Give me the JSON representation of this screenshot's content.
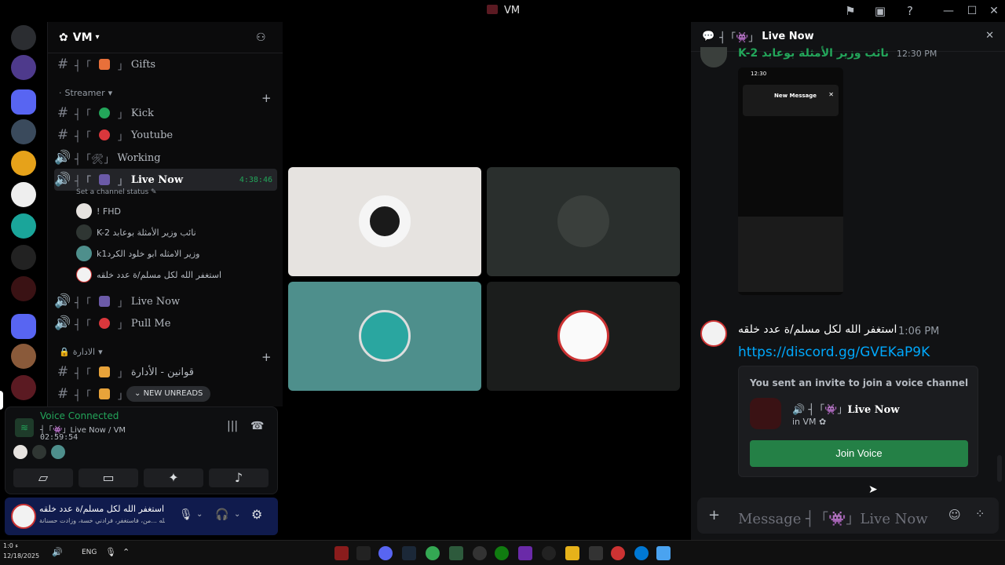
{
  "window": {
    "title": "VM"
  },
  "guild": {
    "name": "VM"
  },
  "channels": {
    "gifts": "Gifts",
    "cat_streamer": "Streamer",
    "kick": "Kick",
    "youtube": "Youtube",
    "working": "Working",
    "live_now": "Live Now",
    "live_timer": "4:38:46",
    "set_status": "Set a channel status",
    "live_now2": "Live Now",
    "pull_me": "Pull Me",
    "cat_admin": "الادارة",
    "admin_rules": "قوانين - الأدارة",
    "admin2": "ء"
  },
  "voice_users": [
    "! FHD",
    "K-2 نائب وزير الأمثلة بوعابد",
    "k1وزير الامثله ابو خلود الكرد",
    "استغفر الله لكل مسلم/ة عدد خلقه"
  ],
  "new_unreads": "NEW UNREADS",
  "voice_panel": {
    "status": "Voice Connected",
    "channel": "Live Now / VM",
    "timer": "02:59:54"
  },
  "user_bar": {
    "name": "استغفر الله لكل مسلم/ة عدد خلقه",
    "status": "سبحان الله ...من، فاستغفر، فرادني خسة، وزادت حسنانة"
  },
  "chat": {
    "header": "Live Now",
    "msg1_author": "K-2 نائب وزير الأمثلة بوعابد",
    "msg1_time": "12:30 PM",
    "phone": {
      "time": "12:30",
      "title": "New Message"
    },
    "msg2_author": "استغفر الله لكل مسلم/ة عدد خلقه",
    "msg2_time": "1:06 PM",
    "msg2_link": "https://discord.gg/GVEKaP9K",
    "invite_text": "You sent an invite to join a voice channel",
    "invite_channel": "Live Now",
    "invite_in": "in VM",
    "join_button": "Join Voice",
    "composer_placeholder": "Message ┤「👾」Live Now"
  },
  "taskbar": {
    "lang": "ENG",
    "date": "12/18/2025",
    "time": "ء 1:0"
  },
  "colors": {
    "accent": "#5865f2",
    "online": "#23a55a",
    "join": "#248046",
    "link": "#00a8fc"
  }
}
